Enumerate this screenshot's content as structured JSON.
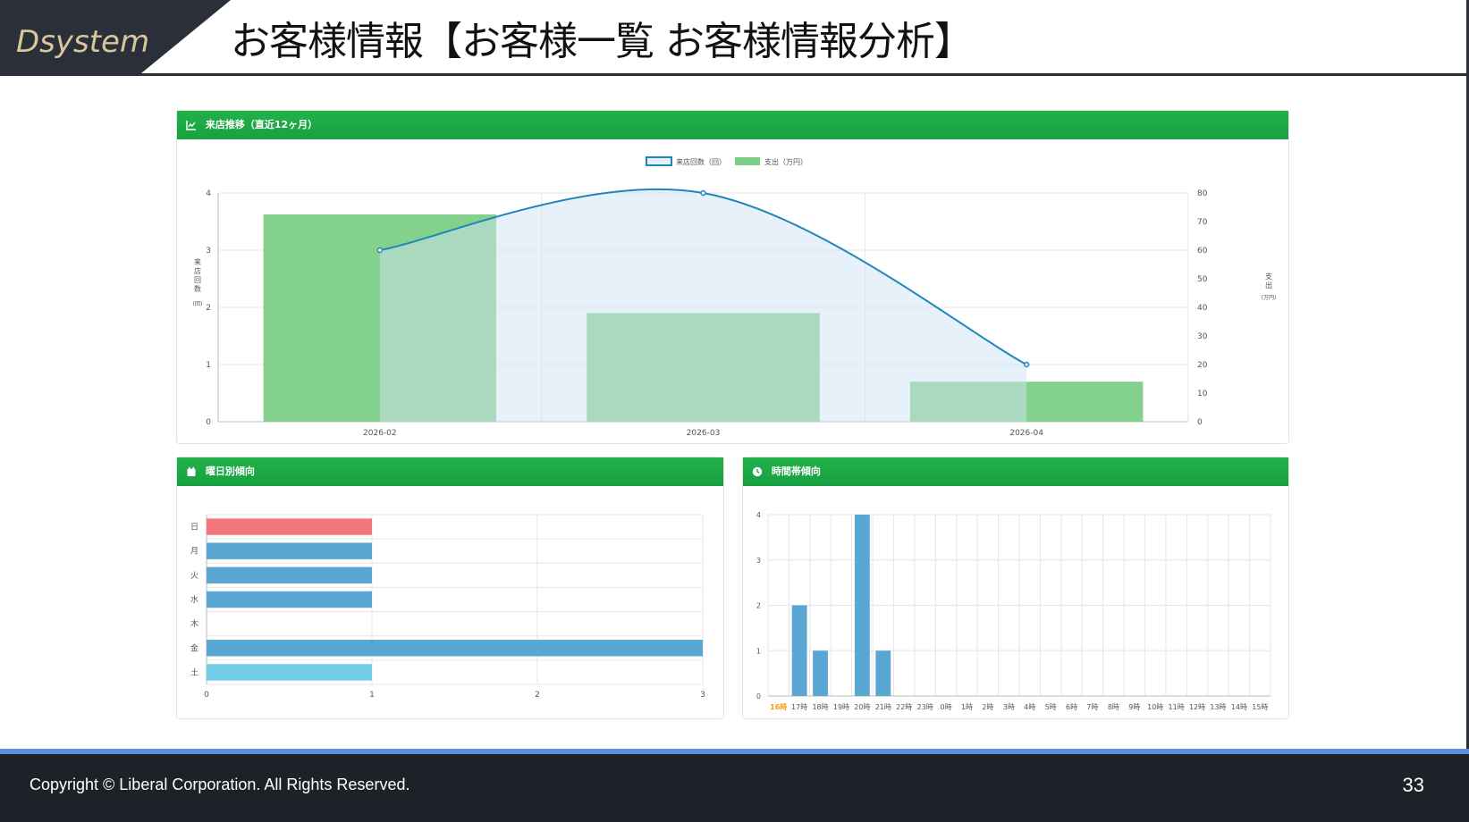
{
  "brand": {
    "logo_text": "Dsystem"
  },
  "page_title": "お客様情報【お客様一覧 お客様情報分析】",
  "colors": {
    "header_green": "#1fa845",
    "line_blue": "#1f86bb",
    "bar_green": "#7ccf86",
    "bar_blue": "#5ba7d4",
    "bar_red": "#f2777b",
    "bar_cyan": "#72cde8",
    "footer_bg": "#1d2228",
    "footer_accent": "#5b8fd9",
    "highlight_orange": "#f39c12"
  },
  "visits_card": {
    "title": "来店推移（直近12ヶ月）",
    "icon": "line-chart-icon"
  },
  "weekday_card": {
    "title": "曜日別傾向",
    "icon": "calendar-icon"
  },
  "hour_card": {
    "title": "時間帯傾向",
    "icon": "clock-icon"
  },
  "chart_data": [
    {
      "type": "bar",
      "id": "visits",
      "categories": [
        "2026-02",
        "2026-03",
        "2026-04"
      ],
      "series": [
        {
          "name": "来店回数（回）",
          "type": "line",
          "axis": "left",
          "values": [
            3,
            4,
            1
          ]
        },
        {
          "name": "支出（万円）",
          "type": "bar",
          "axis": "right",
          "values": [
            72.5,
            38,
            14
          ]
        }
      ],
      "y_left": {
        "label": "来店回数",
        "unit": "(回)",
        "ylim": [
          0,
          4
        ],
        "ticks": [
          0,
          1,
          2,
          3,
          4
        ]
      },
      "y_right": {
        "label": "支出",
        "unit": "(万円)",
        "ylim": [
          0,
          80
        ],
        "ticks": [
          0,
          10,
          20,
          30,
          40,
          50,
          60,
          70,
          80
        ]
      },
      "legend": "top-center",
      "grid": true
    },
    {
      "type": "bar",
      "id": "weekday",
      "orientation": "horizontal",
      "categories": [
        "日",
        "月",
        "火",
        "水",
        "木",
        "金",
        "土"
      ],
      "values": [
        1,
        1,
        1,
        1,
        0,
        3,
        1
      ],
      "bar_colors": [
        "#f2777b",
        "#5ba7d4",
        "#5ba7d4",
        "#5ba7d4",
        "#5ba7d4",
        "#5ba7d4",
        "#72cde8"
      ],
      "xlim": [
        0,
        3
      ],
      "ticks": [
        0,
        1,
        2,
        3
      ],
      "grid": true
    },
    {
      "type": "bar",
      "id": "hour",
      "categories": [
        "16時",
        "17時",
        "18時",
        "19時",
        "20時",
        "21時",
        "22時",
        "23時",
        "0時",
        "1時",
        "2時",
        "3時",
        "4時",
        "5時",
        "6時",
        "7時",
        "8時",
        "9時",
        "10時",
        "11時",
        "12時",
        "13時",
        "14時",
        "15時"
      ],
      "values": [
        0,
        2,
        1,
        0,
        4,
        1,
        0,
        0,
        0,
        0,
        0,
        0,
        0,
        0,
        0,
        0,
        0,
        0,
        0,
        0,
        0,
        0,
        0,
        0
      ],
      "highlight_category": "16時",
      "ylim": [
        0,
        4
      ],
      "ticks": [
        0,
        1,
        2,
        3,
        4
      ],
      "grid": true
    }
  ],
  "footer": {
    "copyright": "Copyright ©  Liberal Corporation. All Rights Reserved.",
    "page_number": "33"
  }
}
